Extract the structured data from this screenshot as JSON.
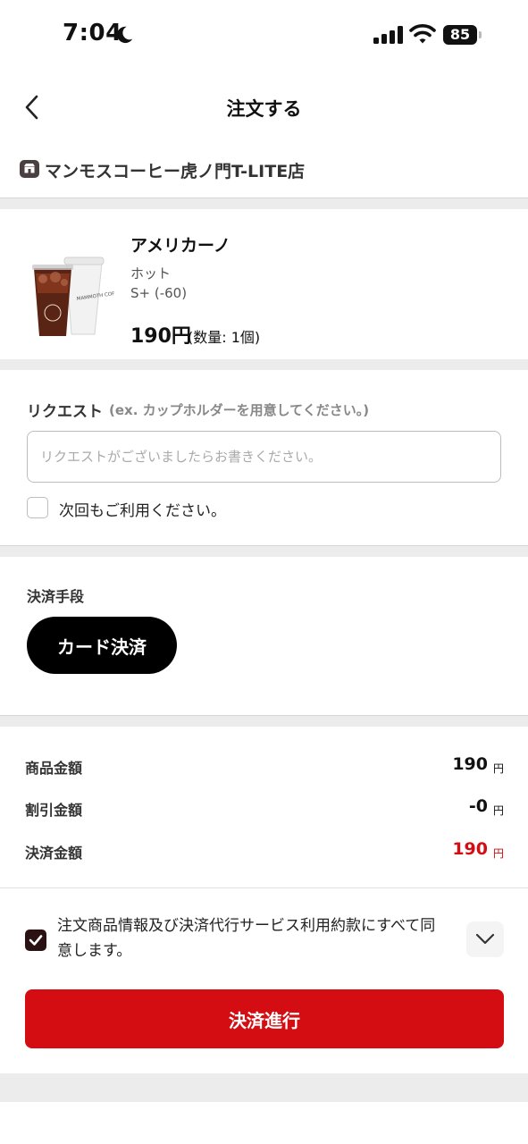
{
  "status_bar": {
    "time": "7:04",
    "battery": "85",
    "icons": [
      "moon-icon",
      "signal-icon",
      "wifi-icon",
      "battery-icon"
    ]
  },
  "header": {
    "title": "注文する",
    "back_icon": "chevron-left-icon"
  },
  "store": {
    "icon": "store-icon",
    "name": "マンモスコーヒー虎ノ門T-LITE店"
  },
  "product": {
    "name": "アメリカーノ",
    "options": [
      "ホット",
      "S+ (-60)"
    ],
    "price": "190円",
    "quantity": "(数量: 1個)",
    "image_text": "MAMMOTH COFFEE"
  },
  "request": {
    "label": "リクエスト",
    "hint": "(ex. カップホルダーを用意してください。)",
    "placeholder": "リクエストがございましたらお書きください。",
    "reuse_label": "次回もご利用ください。"
  },
  "payment": {
    "label": "決済手段",
    "method": "カード決済"
  },
  "summary": {
    "rows": [
      {
        "label": "商品金額",
        "value": "190",
        "unit": "円"
      },
      {
        "label": "割引金額",
        "value": "-0",
        "unit": "円"
      },
      {
        "label": "決済金額",
        "value": "190",
        "unit": "円"
      }
    ]
  },
  "agreement": {
    "text": "注文商品情報及び決済代行サービス利用約款にすべて同意します。",
    "checked": true
  },
  "actions": {
    "proceed": "決済進行"
  },
  "colors": {
    "accent": "#d40d12",
    "dark": "#000000",
    "divider": "#ececec"
  }
}
